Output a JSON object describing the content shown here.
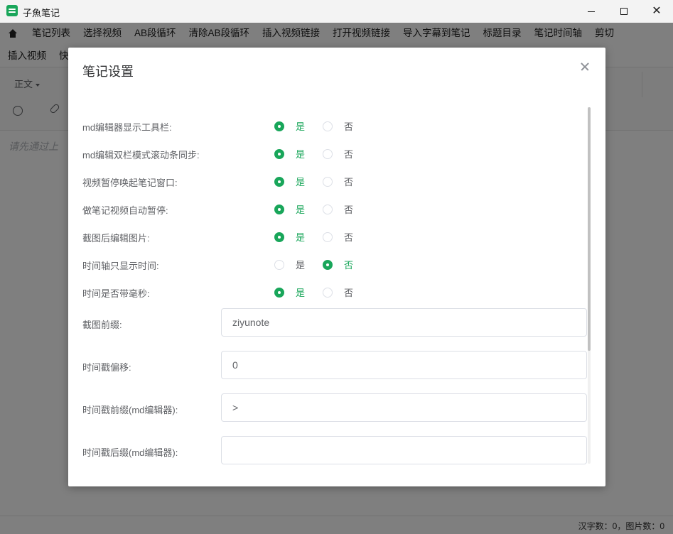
{
  "window": {
    "title": "子魚笔记",
    "minimize_glyph": "",
    "maximize_glyph": "",
    "close_glyph": "✕"
  },
  "menu": {
    "row1": [
      "笔记列表",
      "选择视频",
      "AB段循环",
      "清除AB段循环",
      "插入视频链接",
      "打开视频链接",
      "导入字幕到笔记",
      "标题目录",
      "笔记时间轴",
      "剪切"
    ],
    "row2": [
      "插入视频",
      "快"
    ]
  },
  "toolbar": {
    "paragraph_style": "正文"
  },
  "editor": {
    "placeholder": "请先通过上"
  },
  "status": {
    "text": "汉字数：0，图片数：0"
  },
  "dialog": {
    "title": "笔记设置",
    "options": [
      {
        "label": "md编辑器显示工具栏:",
        "yes": "是",
        "no": "否",
        "selected": "yes"
      },
      {
        "label": "md编辑双栏模式滚动条同步:",
        "yes": "是",
        "no": "否",
        "selected": "yes"
      },
      {
        "label": "视频暂停唤起笔记窗口:",
        "yes": "是",
        "no": "否",
        "selected": "yes"
      },
      {
        "label": "做笔记视频自动暂停:",
        "yes": "是",
        "no": "否",
        "selected": "yes"
      },
      {
        "label": "截图后编辑图片:",
        "yes": "是",
        "no": "否",
        "selected": "yes"
      },
      {
        "label": "时间轴只显示时间:",
        "yes": "是",
        "no": "否",
        "selected": "no"
      },
      {
        "label": "时间是否带毫秒:",
        "yes": "是",
        "no": "否",
        "selected": "yes"
      }
    ],
    "fields": [
      {
        "label": "截图前缀:",
        "value": "ziyunote"
      },
      {
        "label": "时间戳偏移:",
        "value": "0"
      },
      {
        "label": "时间戳前缀(md编辑器):",
        "value": ">"
      },
      {
        "label": "时间戳后缀(md编辑器):",
        "value": ""
      }
    ]
  },
  "colors": {
    "accent": "#19a65a",
    "overlay": "rgba(0,0,0,0.5)"
  }
}
